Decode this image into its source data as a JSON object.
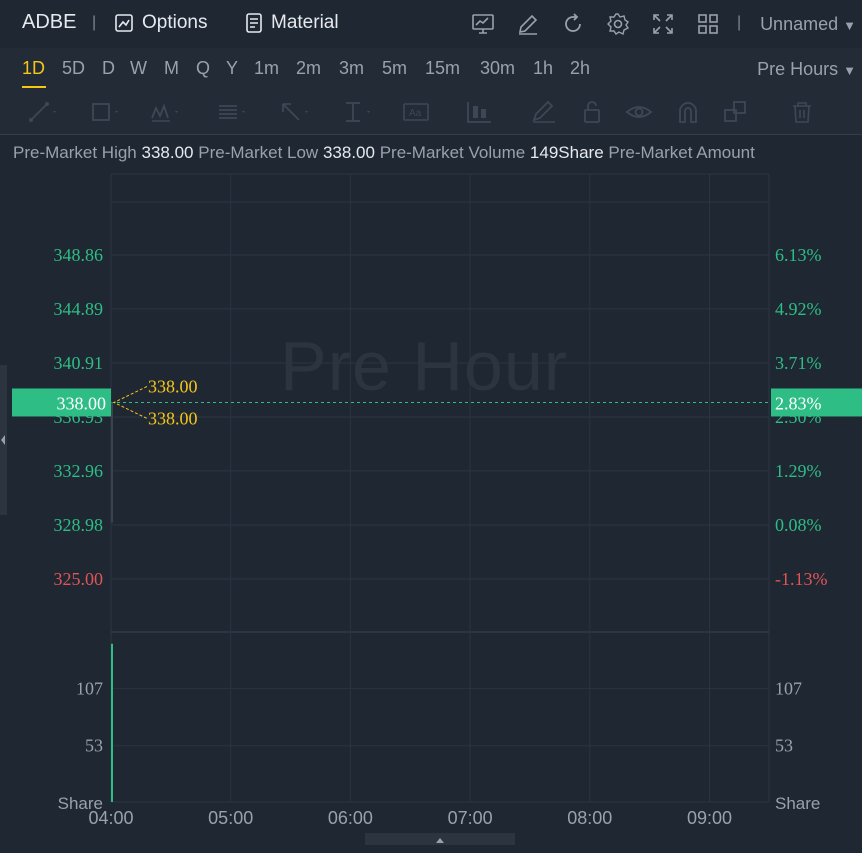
{
  "header": {
    "symbol": "ADBE",
    "separator": "|",
    "options_label": "Options",
    "material_label": "Material",
    "layout_name": "Unnamed"
  },
  "intervals": {
    "items": [
      "1D",
      "5D",
      "D",
      "W",
      "M",
      "Q",
      "Y",
      "1m",
      "2m",
      "3m",
      "5m",
      "15m",
      "30m",
      "1h",
      "2h"
    ],
    "active": "1D",
    "session": "Pre Hours"
  },
  "draw_tools": [
    "line-tool-icon",
    "rectangle-tool-icon",
    "wave-tool-icon",
    "fib-tool-icon",
    "arrow-tool-icon",
    "text-range-tool-icon",
    "text-tool-icon",
    "candle-tool-icon",
    "pencil-icon",
    "lock-icon",
    "eye-icon",
    "magnet-icon",
    "clone-icon",
    "trash-icon"
  ],
  "info": {
    "high_label": "Pre-Market High",
    "high_value": "338.00",
    "low_label": "Pre-Market Low",
    "low_value": "338.00",
    "volume_label": "Pre-Market Volume",
    "volume_value": "149Share",
    "amount_label": "Pre-Market Amount"
  },
  "watermark": "Pre Hour",
  "colors": {
    "up": "#2ebd85",
    "down": "#e05555",
    "accent": "#f5c518",
    "bg": "#1f2733"
  },
  "chart_data": {
    "type": "line",
    "x_ticks": [
      "04:00",
      "05:00",
      "06:00",
      "07:00",
      "08:00",
      "09:00"
    ],
    "price": {
      "ticks": [
        {
          "value": 348.86,
          "label": "348.86",
          "pct": "6.13%",
          "dir": "up"
        },
        {
          "value": 344.89,
          "label": "344.89",
          "pct": "4.92%",
          "dir": "up"
        },
        {
          "value": 340.91,
          "label": "340.91",
          "pct": "3.71%",
          "dir": "up"
        },
        {
          "value": 336.93,
          "label": "336.93",
          "pct": "2.50%",
          "dir": "up"
        },
        {
          "value": 332.96,
          "label": "332.96",
          "pct": "1.29%",
          "dir": "up"
        },
        {
          "value": 328.98,
          "label": "328.98",
          "pct": "0.08%",
          "dir": "up"
        },
        {
          "value": 325.0,
          "label": "325.00",
          "pct": "-1.13%",
          "dir": "down"
        }
      ],
      "last_price": "338.00",
      "last_pct": "2.83%",
      "last_value": 338.0,
      "high_marker": "338.00",
      "low_marker": "338.00"
    },
    "volume": {
      "ticks": [
        {
          "value": 107,
          "label": "107"
        },
        {
          "value": 53,
          "label": "53"
        }
      ],
      "unit": "Share",
      "max": 160,
      "bars": [
        {
          "x": "04:00",
          "value": 149
        }
      ]
    }
  }
}
